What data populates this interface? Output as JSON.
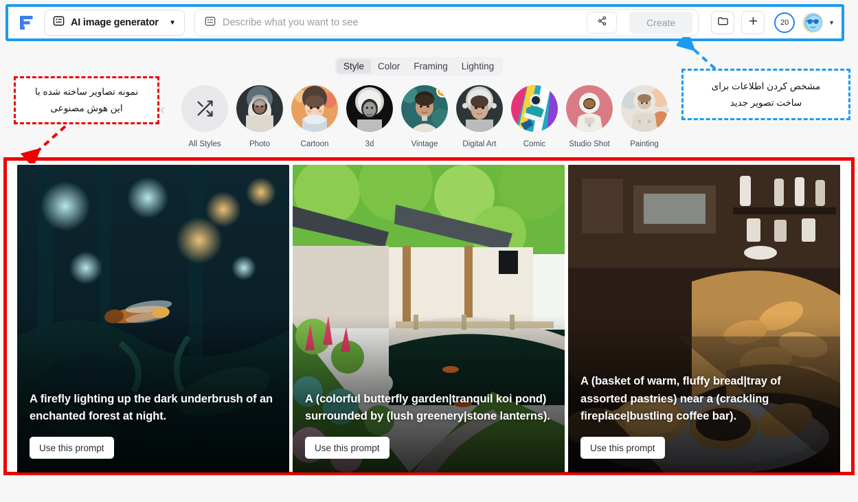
{
  "app": {
    "logo_icon": "freepik-f-logo",
    "brand_color": "#2f7ff0"
  },
  "toolbar": {
    "model_select": {
      "icon": "image-generator-icon",
      "label": "AI image generator",
      "caret_icon": "chevron-down-icon"
    },
    "prompt": {
      "icon": "prompt-icon",
      "value": "",
      "placeholder": "Describe what you want to see"
    },
    "share_icon": "share-icon",
    "create_label": "Create",
    "folder_icon": "folder-icon",
    "add_icon": "plus-icon",
    "credits": "20",
    "avatar_icon": "user-avatar-sunglasses",
    "avatar_caret_icon": "chevron-down-icon"
  },
  "filters": {
    "tabs": [
      {
        "label": "Style",
        "active": true
      },
      {
        "label": "Color",
        "active": false
      },
      {
        "label": "Framing",
        "active": false
      },
      {
        "label": "Lighting",
        "active": false
      }
    ]
  },
  "styles": {
    "prev_icon": "chevron-left-icon",
    "next_icon": "chevron-right-icon",
    "items": [
      {
        "label": "All Styles",
        "icon": "shuffle-icon",
        "premium": false
      },
      {
        "label": "Photo",
        "icon": "style-thumb-photo",
        "premium": false
      },
      {
        "label": "Cartoon",
        "icon": "style-thumb-cartoon",
        "premium": false
      },
      {
        "label": "3d",
        "icon": "style-thumb-3d",
        "premium": false
      },
      {
        "label": "Vintage",
        "icon": "style-thumb-vintage",
        "premium": true,
        "badge_icon": "crown-icon"
      },
      {
        "label": "Digital Art",
        "icon": "style-thumb-digital-art",
        "premium": false
      },
      {
        "label": "Comic",
        "icon": "style-thumb-comic",
        "premium": false
      },
      {
        "label": "Studio Shot",
        "icon": "style-thumb-studio-shot",
        "premium": false
      },
      {
        "label": "Painting",
        "icon": "style-thumb-painting",
        "premium": false
      }
    ]
  },
  "gallery": {
    "cards": [
      {
        "prompt": "A firefly lighting up the dark underbrush of an enchanted forest at night.",
        "button_label": "Use this prompt",
        "image_name": "firefly-forest-night"
      },
      {
        "prompt": "A (colorful butterfly garden|tranquil koi pond) surrounded by (lush greenery|stone lanterns).",
        "button_label": "Use this prompt",
        "image_name": "koi-pond-garden"
      },
      {
        "prompt": "A (basket of warm, fluffy bread|tray of assorted pastries) near a (crackling fireplace|bustling coffee bar).",
        "button_label": "Use this prompt",
        "image_name": "bread-basket-bakery"
      }
    ]
  },
  "annotations": {
    "red": {
      "line1": "نمونه تصاویر ساخته شده با",
      "line2": "این هوش مصنوعی",
      "color": "#ee0000"
    },
    "blue": {
      "line1": "مشخص کردن اطلاعات برای",
      "line2": "ساخت تصویر جدید",
      "color": "#1e9bf0"
    }
  }
}
